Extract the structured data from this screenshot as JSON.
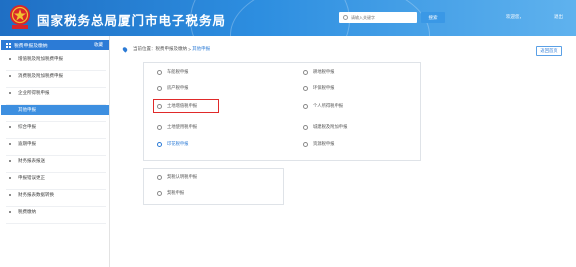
{
  "header": {
    "title": "国家税务总局厦门市电子税务局",
    "search_placeholder": "请输入关键字",
    "search_label": "搜索",
    "user": "欢迎您，",
    "logout": "退出"
  },
  "sidebar": {
    "title": "税费申报及缴纳",
    "fav": "收藏",
    "items": [
      {
        "label": "增值税及附加税费申报",
        "type": "item"
      },
      {
        "label": "消费税及附加税费申报",
        "type": "item"
      },
      {
        "label": "企业所得税申报",
        "type": "item"
      },
      {
        "label": "其他申报",
        "type": "active"
      },
      {
        "label": "综合申报",
        "type": "item"
      },
      {
        "label": "逾期申报",
        "type": "item"
      },
      {
        "label": "财务报表报送",
        "type": "item"
      },
      {
        "label": "申报错误更正",
        "type": "item"
      },
      {
        "label": "财务报表数据转换",
        "type": "item"
      },
      {
        "label": "税费缴纳",
        "type": "item"
      }
    ]
  },
  "breadcrumb": {
    "prefix": "当前位置：",
    "parent": "税费申报及缴纳",
    "sep": " > ",
    "current": "其他申报"
  },
  "return_label": "返回首页",
  "panel1": {
    "left": [
      "车船税申报",
      "房产税申报",
      "土地增值税申报",
      "土地使用税申报",
      "印花税申报"
    ],
    "right": [
      "耕地税申报",
      "环保税申报",
      "个人所得税申报",
      "城建税及附加申报",
      "资源税申报"
    ]
  },
  "panel2": {
    "left": [
      "契税认明税申报",
      "契税申报"
    ]
  }
}
